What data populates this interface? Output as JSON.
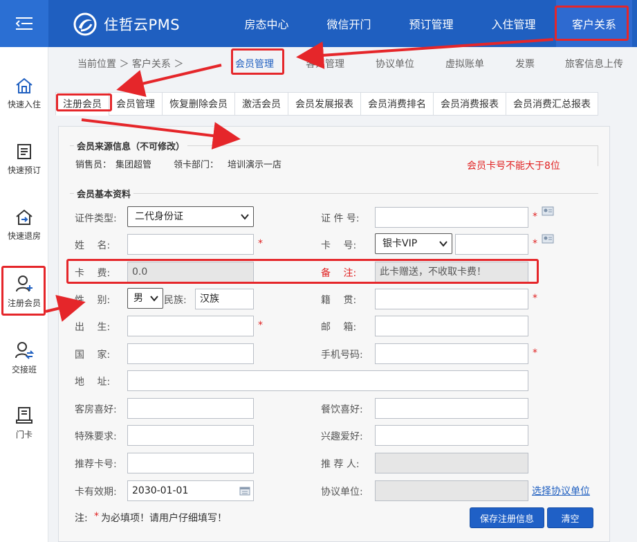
{
  "header": {
    "logo_text": "住哲云PMS",
    "nav": [
      "房态中心",
      "微信开门",
      "预订管理",
      "入住管理",
      "客户关系"
    ]
  },
  "sidebar": {
    "items": [
      {
        "label": "快速入住",
        "icon": "home-icon"
      },
      {
        "label": "快速预订",
        "icon": "document-icon"
      },
      {
        "label": "快速退房",
        "icon": "checkout-icon"
      },
      {
        "label": "注册会员",
        "icon": "add-user-icon"
      },
      {
        "label": "交接班",
        "icon": "shift-user-icon"
      },
      {
        "label": "门卡",
        "icon": "card-icon"
      }
    ]
  },
  "breadcrumb": "当前位置 ＞ 客户关系 ＞",
  "subtabs": [
    "会员管理",
    "客人管理",
    "协议单位",
    "虚拟账单",
    "发票",
    "旅客信息上传"
  ],
  "tabs3": [
    "注册会员",
    "会员管理",
    "恢复删除会员",
    "激活会员",
    "会员发展报表",
    "会员消费排名",
    "会员消费报表",
    "会员消费汇总报表"
  ],
  "source_info": {
    "legend": "会员来源信息（不可修改）",
    "seller_label": "销售员：",
    "seller": "集团超管",
    "dept_label": "领卡部门：",
    "dept": "培训演示一店",
    "warning": "会员卡号不能大于8位"
  },
  "basic": {
    "legend": "会员基本资料",
    "id_type_label": "证件类型:",
    "id_type_value": "二代身份证",
    "id_no_label": "证 件 号:",
    "name_label": "姓　 名:",
    "card_no_label": "卡　 号:",
    "card_type_value": "银卡VIP",
    "card_fee_label": "卡　 费:",
    "card_fee_value": "0.0",
    "remark_label": "备　 注:",
    "remark_value": "此卡赠送，不收取卡费！",
    "gender_label": "性　 别:",
    "gender_value": "男",
    "ethnic_label": "民族:",
    "ethnic_value": "汉族",
    "native_label": "籍　 贯:",
    "birth_label": "出　 生:",
    "email_label": "邮　 箱:",
    "country_label": "国　 家:",
    "mobile_label": "手机号码:",
    "address_label": "地　 址:",
    "room_pref_label": "客房喜好:",
    "food_pref_label": "餐饮喜好:",
    "special_label": "特殊要求:",
    "hobby_label": "兴趣爱好:",
    "ref_card_label": "推荐卡号:",
    "referrer_label": "推 荐 人:",
    "expiry_label": "卡有效期:",
    "expiry_value": "2030-01-01",
    "agreement_label": "协议单位:",
    "agreement_link": "选择协议单位",
    "required_mark": "*"
  },
  "note": {
    "prefix": "注:",
    "star": "*",
    "text": "为必填项！请用户仔细填写！"
  },
  "buttons": {
    "save": "保存注册信息",
    "clear": "清空"
  },
  "colors": {
    "header": "#1f5fc0",
    "accent": "#1f60c6",
    "annotation": "#e5262a"
  }
}
